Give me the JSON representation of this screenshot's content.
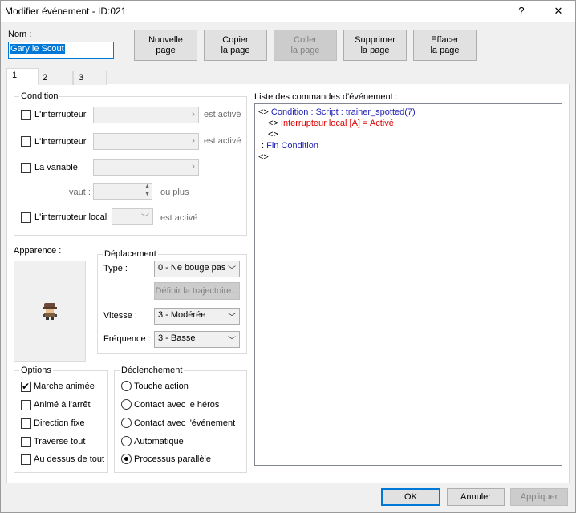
{
  "window": {
    "title": "Modifier événement - ID:021",
    "help_glyph": "?",
    "close_glyph": "✕"
  },
  "name": {
    "label": "Nom :",
    "value": "Gary le Scout"
  },
  "page_buttons": {
    "new": [
      "Nouvelle",
      "page"
    ],
    "copy": [
      "Copier",
      "la page"
    ],
    "paste": [
      "Coller",
      "la page"
    ],
    "delete": [
      "Supprimer",
      "la page"
    ],
    "clear": [
      "Effacer",
      "la page"
    ]
  },
  "tabs": [
    "1",
    "2",
    "3"
  ],
  "condition": {
    "legend": "Condition",
    "switch1": {
      "label": "L'interrupteur",
      "suffix": "est activé"
    },
    "switch2": {
      "label": "L'interrupteur",
      "suffix": "est activé"
    },
    "variable": {
      "label": "La variable",
      "vaut": "vaut :",
      "suffix": "ou plus"
    },
    "local_switch": {
      "label": "L'interrupteur local",
      "suffix": "est activé"
    }
  },
  "appearance": {
    "label": "Apparence :"
  },
  "movement": {
    "legend": "Déplacement",
    "type": {
      "label": "Type :",
      "value": "0 - Ne bouge pas"
    },
    "route_button": "Définir la trajectoire...",
    "speed": {
      "label": "Vitesse :",
      "value": "3 - Modérée"
    },
    "frequency": {
      "label": "Fréquence :",
      "value": "3 - Basse"
    }
  },
  "options": {
    "legend": "Options",
    "items": [
      {
        "label": "Marche animée",
        "checked": true
      },
      {
        "label": "Animé à l'arrêt",
        "checked": false
      },
      {
        "label": "Direction fixe",
        "checked": false
      },
      {
        "label": "Traverse tout",
        "checked": false
      },
      {
        "label": "Au dessus de tout",
        "checked": false
      }
    ]
  },
  "trigger": {
    "legend": "Déclenchement",
    "items": [
      {
        "label": "Touche action",
        "selected": false
      },
      {
        "label": "Contact avec le héros",
        "selected": false
      },
      {
        "label": "Contact avec l'événement",
        "selected": false
      },
      {
        "label": "Automatique",
        "selected": false
      },
      {
        "label": "Processus parallèle",
        "selected": true
      }
    ]
  },
  "commands": {
    "label": "Liste des commandes d'événement :",
    "lines": [
      {
        "marker": "<>",
        "text": "Condition : Script : trainer_spotted(7)",
        "color": "#1f1fb4"
      },
      {
        "marker": "<>",
        "text": "Interrupteur local [A] = Activé",
        "color": "#e00000"
      },
      {
        "marker": "<>",
        "text": "",
        "color": "#000000"
      },
      {
        "marker": ":",
        "text": "Fin Condition",
        "color": "#1f1fb4"
      },
      {
        "marker": "<>",
        "text": "",
        "color": "#000000"
      }
    ]
  },
  "footer": {
    "ok": "OK",
    "cancel": "Annuler",
    "apply": "Appliquer"
  }
}
